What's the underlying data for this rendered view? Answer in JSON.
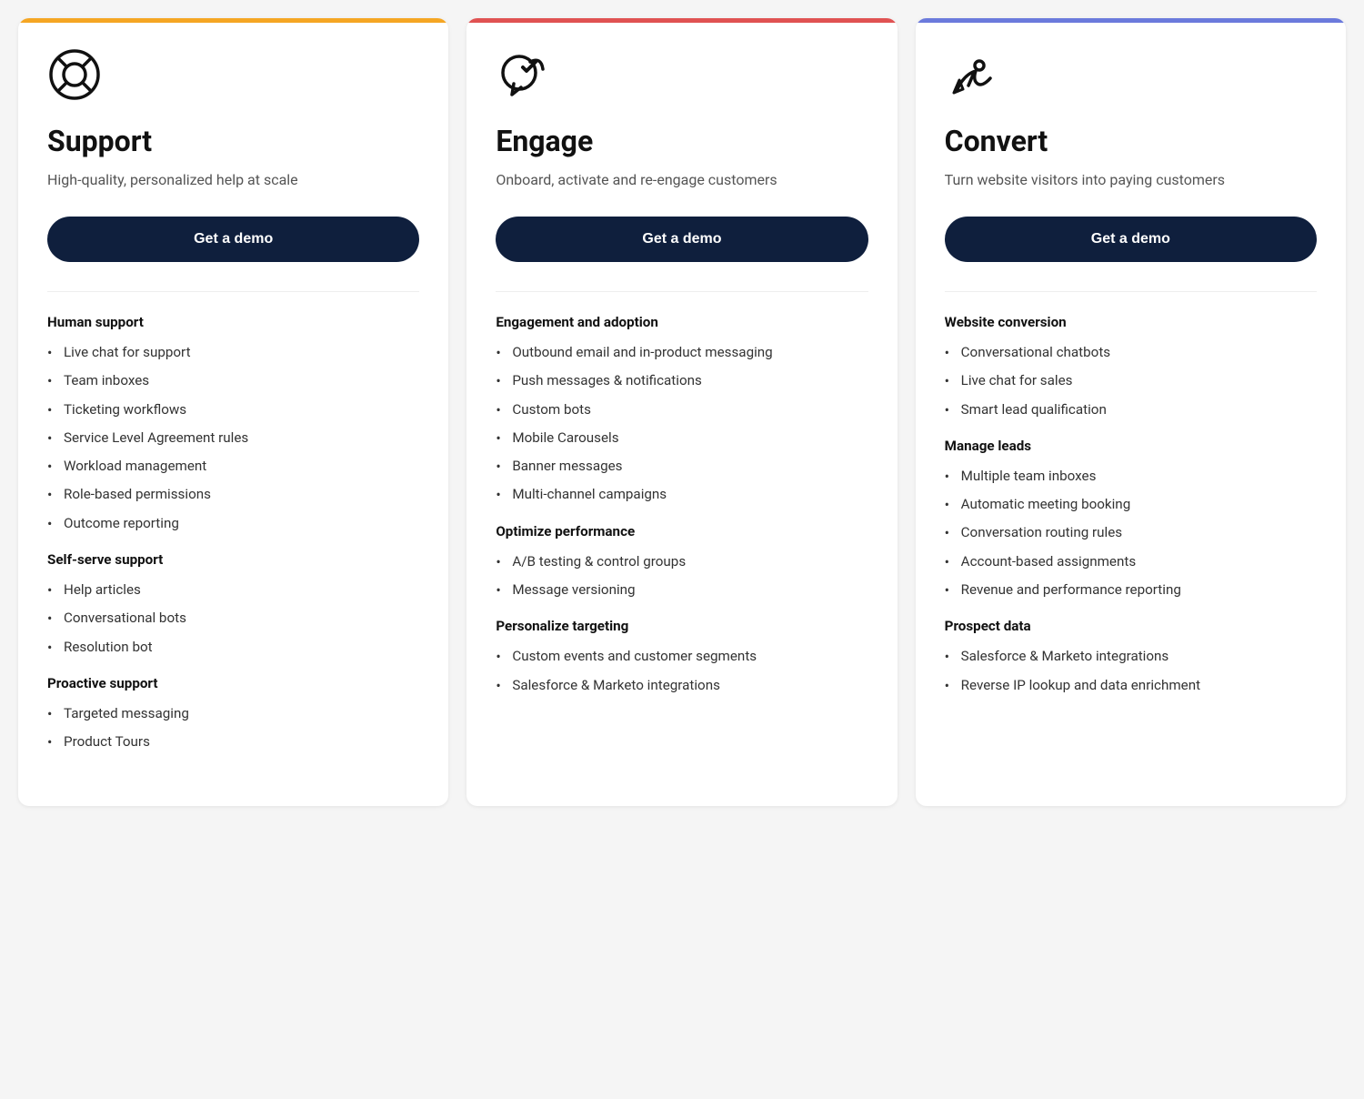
{
  "cards": [
    {
      "id": "support",
      "icon": "support-icon",
      "title": "Support",
      "subtitle": "High-quality, personalized help at scale",
      "btn_label": "Get a demo",
      "accent": "#f5a623",
      "sections": [
        {
          "heading": "Human support",
          "items": [
            "Live chat for support",
            "Team inboxes",
            "Ticketing workflows",
            "Service Level Agreement rules",
            "Workload management",
            "Role-based permissions",
            "Outcome reporting"
          ]
        },
        {
          "heading": "Self-serve support",
          "items": [
            "Help articles",
            "Conversational bots",
            "Resolution bot"
          ]
        },
        {
          "heading": "Proactive support",
          "items": [
            "Targeted messaging",
            "Product Tours"
          ]
        }
      ]
    },
    {
      "id": "engage",
      "icon": "engage-icon",
      "title": "Engage",
      "subtitle": "Onboard, activate and re-engage customers",
      "btn_label": "Get a demo",
      "accent": "#e05252",
      "sections": [
        {
          "heading": "Engagement and adoption",
          "items": [
            "Outbound email and in-product messaging",
            "Push messages & notifications",
            "Custom bots",
            "Mobile Carousels",
            "Banner messages",
            "Multi-channel campaigns"
          ]
        },
        {
          "heading": "Optimize performance",
          "items": [
            "A/B testing & control groups",
            "Message versioning"
          ]
        },
        {
          "heading": "Personalize targeting",
          "items": [
            "Custom events and customer segments",
            "Salesforce & Marketo integrations"
          ]
        }
      ]
    },
    {
      "id": "convert",
      "icon": "convert-icon",
      "title": "Convert",
      "subtitle": "Turn website visitors into paying customers",
      "btn_label": "Get a demo",
      "accent": "#6b7adc",
      "sections": [
        {
          "heading": "Website conversion",
          "items": [
            "Conversational chatbots",
            "Live chat for sales",
            "Smart lead qualification"
          ]
        },
        {
          "heading": "Manage leads",
          "items": [
            "Multiple team inboxes",
            "Automatic meeting booking",
            "Conversation routing rules",
            "Account-based assignments",
            "Revenue and performance reporting"
          ]
        },
        {
          "heading": "Prospect data",
          "items": [
            "Salesforce & Marketo integrations",
            "Reverse IP lookup and data enrichment"
          ]
        }
      ]
    }
  ]
}
